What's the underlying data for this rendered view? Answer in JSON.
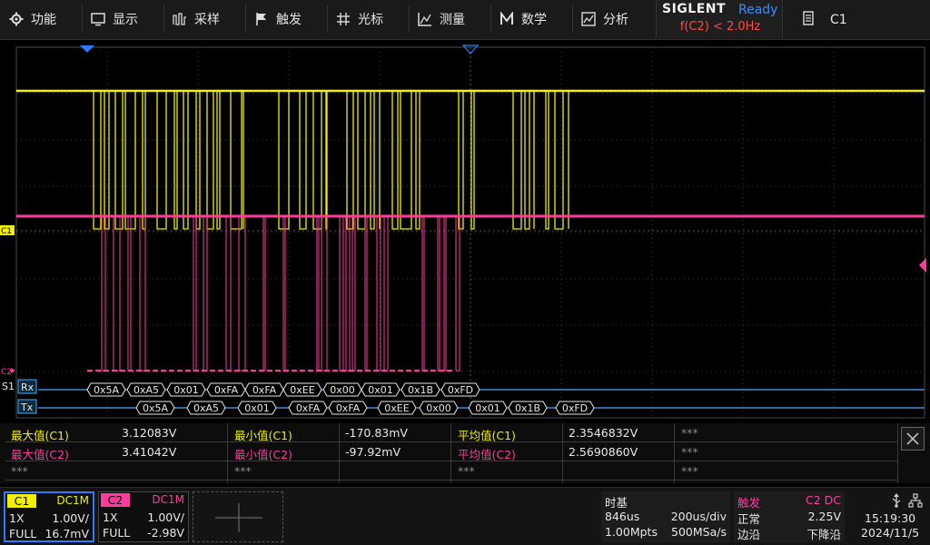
{
  "menu": {
    "items": [
      {
        "label": "功能",
        "icon": "gear-icon"
      },
      {
        "label": "显示",
        "icon": "display-icon"
      },
      {
        "label": "采样",
        "icon": "acquire-icon"
      },
      {
        "label": "触发",
        "icon": "trigger-flag-icon"
      },
      {
        "label": "光标",
        "icon": "cursor-icon"
      },
      {
        "label": "测量",
        "icon": "measure-icon"
      },
      {
        "label": "数学",
        "icon": "math-icon"
      },
      {
        "label": "分析",
        "icon": "analysis-icon"
      }
    ],
    "brand": "SIGLENT",
    "run_status": "Ready",
    "trigger_condition": "f(C2) < 2.0Hz",
    "channel_select": "C1"
  },
  "scope": {
    "ch1_marker": "C1",
    "ch2_marker": "C2",
    "serial_label": "S1",
    "rx_label": "Rx",
    "tx_label": "Tx",
    "rx_bytes": [
      "0x5A",
      "0xA5",
      "0x01",
      "0xFA",
      "0xFA",
      "0xEE",
      "0x00",
      "0x01",
      "0x1B",
      "0xFD"
    ],
    "tx_bytes": [
      "0x5A",
      "0xA5",
      "0x01",
      "0xFA",
      "0xFA",
      "0xEE",
      "0x00",
      "0x01",
      "0x1B",
      "0xFD"
    ],
    "colors": {
      "ch1": "#f0f000",
      "ch2": "#ff3c9e",
      "bus": "#4aa8ff",
      "grid": "#3a3a3a"
    }
  },
  "measurements": {
    "rows": [
      [
        {
          "label": "最大值(C1)",
          "value": "3.12083V",
          "ch": "c1"
        },
        {
          "label": "最小值(C1)",
          "value": "-170.83mV",
          "ch": "c1"
        },
        {
          "label": "平均值(C1)",
          "value": "2.3546832V",
          "ch": "c1"
        },
        {
          "label": "***",
          "value": "",
          "ch": "none"
        }
      ],
      [
        {
          "label": "最大值(C2)",
          "value": "3.41042V",
          "ch": "c2"
        },
        {
          "label": "最小值(C2)",
          "value": "-97.92mV",
          "ch": "c2"
        },
        {
          "label": "平均值(C2)",
          "value": "2.5690860V",
          "ch": "c2"
        },
        {
          "label": "***",
          "value": "",
          "ch": "none"
        }
      ],
      [
        {
          "label": "***",
          "value": "",
          "ch": "none"
        },
        {
          "label": "***",
          "value": "",
          "ch": "none"
        },
        {
          "label": "***",
          "value": "",
          "ch": "none"
        },
        {
          "label": "***",
          "value": "",
          "ch": "none"
        }
      ]
    ]
  },
  "channels": {
    "c1": {
      "name": "C1",
      "coupling": "DC1M",
      "probe": "1X",
      "scale": "1.00V/",
      "bw": "FULL",
      "offset": "16.7mV"
    },
    "c2": {
      "name": "C2",
      "coupling": "DC1M",
      "probe": "1X",
      "scale": "1.00V/",
      "bw": "FULL",
      "offset": "-2.98V"
    }
  },
  "timebase": {
    "title": "时基",
    "delay": "846us",
    "scale": "200us/div",
    "points": "1.00Mpts",
    "rate": "500MSa/s"
  },
  "trigger": {
    "title": "触发",
    "source": "C2 DC",
    "mode": "正常",
    "level": "2.25V",
    "type": "边沿",
    "slope": "下降沿"
  },
  "clock": {
    "time": "15:19:30",
    "date": "2024/11/5"
  }
}
